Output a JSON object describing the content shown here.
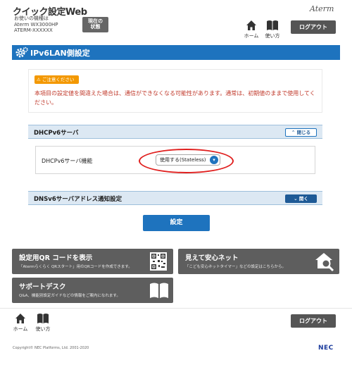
{
  "header": {
    "app_title": "クイック設定Web",
    "device_line1": "お使いの機種は",
    "device_line2": "Aterm WX3000HP",
    "device_line3": "ATERM-XXXXXX",
    "status_label_line1": "現在の",
    "status_label_line2": "状態",
    "brand": "Aterm",
    "home_label": "ホーム",
    "usage_label": "使い方",
    "logout_label": "ログアウト"
  },
  "page": {
    "title": "IPv6LAN側設定"
  },
  "notice": {
    "badge": "ご注意ください",
    "text": "本項目の設定値を間違えた場合は、通信ができなくなる可能性があります。通常は、初期値のままで使用してください。"
  },
  "sections": {
    "dhcpv6": {
      "title": "DHCPv6サーバ",
      "toggle_label": "閉じる",
      "field_label": "DHCPv6サーバ機能",
      "select_value": "使用する(Stateless)"
    },
    "dnsv6": {
      "title": "DNSv6サーバアドレス通知設定",
      "toggle_label": "開く"
    }
  },
  "submit_label": "設定",
  "tiles": {
    "qr": {
      "title": "設定用QR コードを表示",
      "desc": "「Atermらくらく QRスタート」用のQRコードを作成できます。",
      "icon": "qr-code-icon"
    },
    "safe_net": {
      "title": "見えて安心ネット",
      "desc": "「こども安心ネットタイマー」などの設定はこちらから。",
      "icon": "house-search-icon"
    },
    "support": {
      "title": "サポートデスク",
      "desc": "Q&A、機能別設定ガイドなどの情報をご案内になれます。",
      "icon": "book-icon"
    }
  },
  "footer": {
    "home_label": "ホーム",
    "usage_label": "使い方",
    "logout_label": "ログアウト",
    "copyright": "Copyright© NEC Platforms, Ltd. 2001-2020",
    "nec_logo": "NEC"
  },
  "colors": {
    "primary_blue": "#1e73be",
    "section_bg": "#dce8f3",
    "warning_orange": "#f39800",
    "warning_text": "#c0392b",
    "highlight_red": "#e0201f",
    "tile_gray": "#5e5e5e"
  }
}
